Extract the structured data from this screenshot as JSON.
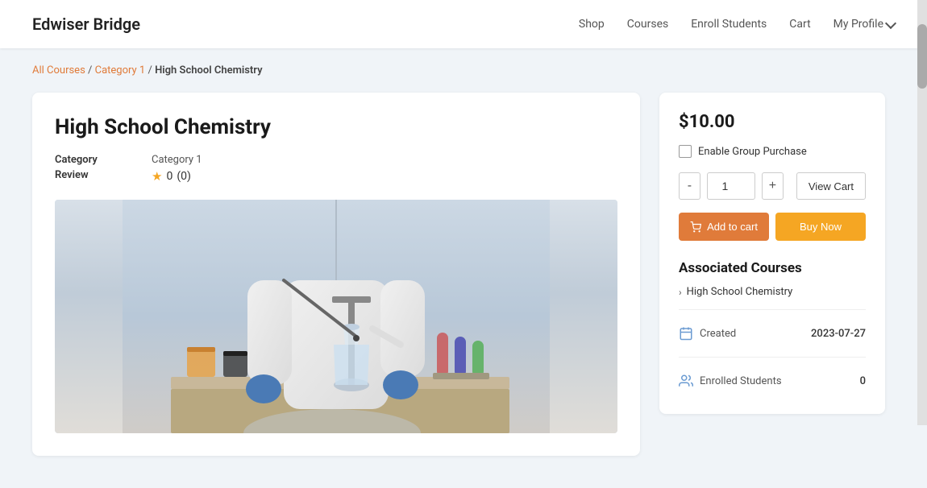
{
  "header": {
    "logo": "Edwiser Bridge",
    "nav": [
      {
        "label": "Shop",
        "href": "#"
      },
      {
        "label": "Courses",
        "href": "#"
      },
      {
        "label": "Enroll Students",
        "href": "#"
      },
      {
        "label": "Cart",
        "href": "#"
      },
      {
        "label": "My Profile",
        "href": "#"
      }
    ]
  },
  "breadcrumb": {
    "all_courses": "All Courses",
    "separator1": " / ",
    "category": "Category 1",
    "separator2": " / ",
    "current": "High School Chemistry"
  },
  "course": {
    "title": "High School Chemistry",
    "meta": {
      "category_label": "Category",
      "category_value": "Category 1",
      "review_label": "Review",
      "rating": "0",
      "review_count": "(0)"
    },
    "image_alt": "Chemistry lab scene"
  },
  "sidebar": {
    "price": "$10.00",
    "group_purchase_label": "Enable Group Purchase",
    "quantity": "1",
    "minus_label": "-",
    "plus_label": "+",
    "view_cart_label": "View Cart",
    "add_to_cart_label": "Add to cart",
    "buy_now_label": "Buy Now",
    "associated_title": "Associated Courses",
    "associated_course": "High School Chemistry",
    "created_label": "Created",
    "created_value": "2023-07-27",
    "enrolled_label": "Enrolled Students",
    "enrolled_value": "0"
  }
}
